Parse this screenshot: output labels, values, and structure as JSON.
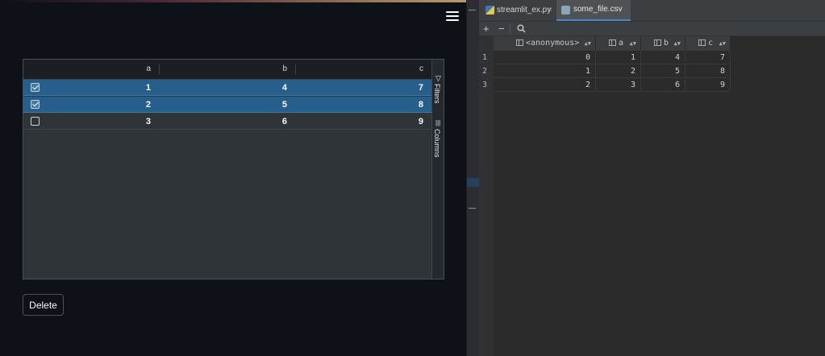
{
  "grid": {
    "columns": [
      "a",
      "b",
      "c"
    ],
    "rows": [
      {
        "selected": true,
        "a": "1",
        "b": "4",
        "c": "7"
      },
      {
        "selected": true,
        "a": "2",
        "b": "5",
        "c": "8"
      },
      {
        "selected": false,
        "a": "3",
        "b": "6",
        "c": "9"
      }
    ],
    "side_tabs": {
      "filters": "Filters",
      "columns": "Columns"
    }
  },
  "buttons": {
    "delete": "Delete"
  },
  "ide": {
    "tabs": [
      {
        "label": "streamlit_ex.py",
        "active": false,
        "icon": "python-file-icon"
      },
      {
        "label": "some_file.csv",
        "active": true,
        "icon": "csv-file-icon"
      }
    ],
    "toolbar": {
      "add": "+",
      "remove": "−",
      "search": "search-icon"
    },
    "table": {
      "columns": [
        "<anonymous>",
        "a",
        "b",
        "c"
      ],
      "rows": [
        {
          "num": "1",
          "values": [
            "0",
            "1",
            "4",
            "7"
          ]
        },
        {
          "num": "2",
          "values": [
            "1",
            "2",
            "5",
            "8"
          ]
        },
        {
          "num": "3",
          "values": [
            "2",
            "3",
            "6",
            "9"
          ]
        }
      ]
    }
  },
  "colors": {
    "app_bg": "#0e1117",
    "grid_bg": "#2e3438",
    "selected_row": "#265f8b",
    "ide_bg": "#2b2b2b",
    "ide_tab_accent": "#4a88c7"
  }
}
